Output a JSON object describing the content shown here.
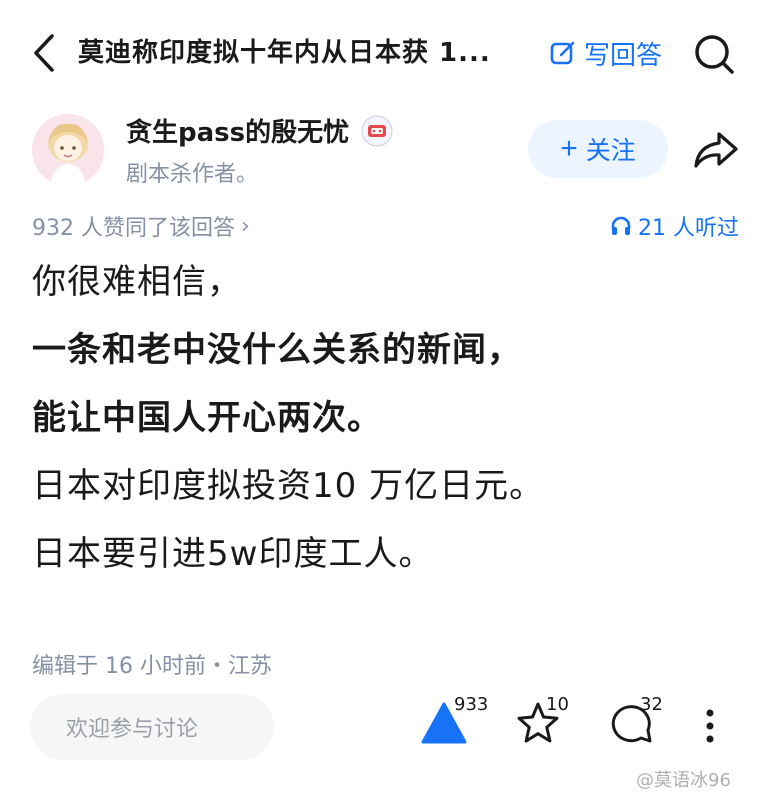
{
  "header": {
    "title": "莫迪称印度拟十年内从日本获 1...",
    "write_answer_label": "写回答",
    "icons": {
      "back": "chevron-left-icon",
      "write": "edit-icon",
      "search": "search-icon"
    }
  },
  "author": {
    "name": "贪生pass的殷无忧",
    "bio": "剧本杀作者。",
    "follow_label": "关注",
    "follow_plus": "+"
  },
  "meta": {
    "agree_text": "932 人赞同了该回答",
    "agree_chevron": "›",
    "listen_text": "21 人听过"
  },
  "content": {
    "paragraphs": [
      {
        "text": "你很难相信，",
        "bold": false
      },
      {
        "text": "一条和老中没什么关系的新闻，",
        "bold": true
      },
      {
        "text": "能让中国人开心两次。",
        "bold": true
      },
      {
        "text": "日本对印度拟投资10 万亿日元。",
        "bold": false
      },
      {
        "text": "日本要引进5w印度工人。",
        "bold": false
      }
    ]
  },
  "edit_info": "编辑于 16 小时前・江苏",
  "bottom": {
    "comment_placeholder": "欢迎参与讨论",
    "vote_count": "933",
    "favorite_count": "10",
    "comment_count": "32"
  },
  "watermark": "@莫语冰96",
  "colors": {
    "accent": "#1772f6",
    "muted": "#8590a6",
    "follow_bg": "#ebf4ff"
  }
}
